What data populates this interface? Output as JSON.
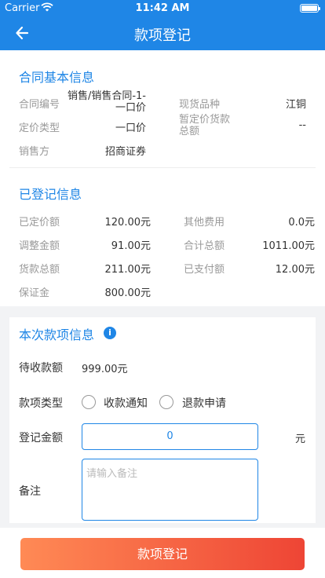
{
  "status_bar": {
    "carrier": "Carrier",
    "time": "11:42 AM"
  },
  "nav": {
    "title": "款项登记"
  },
  "contract_info": {
    "title": "合同基本信息",
    "contract_no_label": "合同编号",
    "contract_no_line1": "销售/销售合同-1-",
    "contract_no_line2": "一口价",
    "product_label": "现货品种",
    "product_value": "江铜",
    "pricing_type_label": "定价类型",
    "pricing_type_value": "一口价",
    "provisional_label_line1": "暂定价货款",
    "provisional_label_line2": "总额",
    "provisional_value": "--",
    "seller_label": "销售方",
    "seller_value": "招商证券"
  },
  "registered_info": {
    "title": "已登记信息",
    "priced_amount_label": "已定价额",
    "priced_amount_value": "120.00元",
    "other_fees_label": "其他费用",
    "other_fees_value": "0.0元",
    "adjust_amount_label": "调整金额",
    "adjust_amount_value": "91.00元",
    "total_amount_label": "合计总额",
    "total_amount_value": "1011.00元",
    "goods_total_label": "货款总额",
    "goods_total_value": "211.00元",
    "paid_amount_label": "已支付额",
    "paid_amount_value": "12.00元",
    "deposit_label": "保证金",
    "deposit_value": "800.00元"
  },
  "payment_form": {
    "title": "本次款项信息",
    "info_icon": "info-icon",
    "receivable_label": "待收款额",
    "receivable_value": "999.00元",
    "type_label": "款项类型",
    "type_option_1": "收款通知",
    "type_option_2": "退款申请",
    "amount_label": "登记金额",
    "amount_value": "0",
    "amount_unit": "元",
    "remark_label": "备注",
    "remark_placeholder": "请输入备注"
  },
  "submit": {
    "label": "款项登记"
  },
  "colors": {
    "primary": "#1f86e6",
    "button_start": "#ff8a55",
    "button_end": "#ee4535"
  }
}
